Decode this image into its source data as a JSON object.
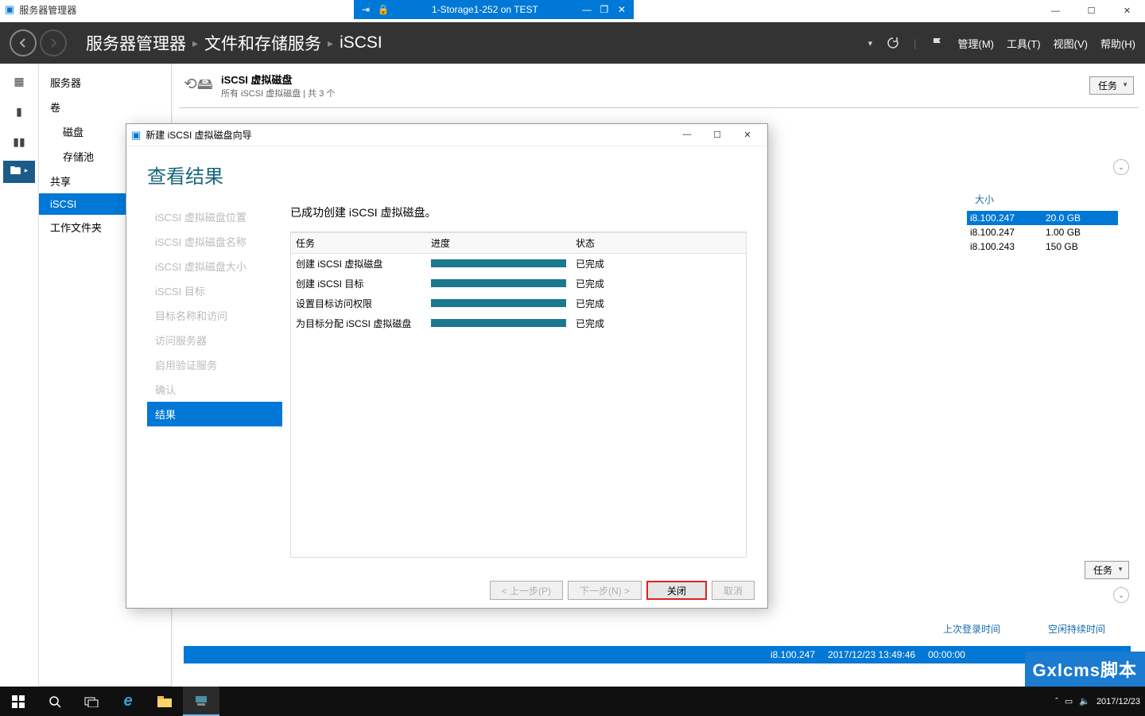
{
  "host_window": {
    "min": "—",
    "max": "☐",
    "close": "✕"
  },
  "vm_bar": {
    "title": "1-Storage1-252 on TEST",
    "pin": "📌",
    "lock": "🔒",
    "min": "—",
    "max": "❐",
    "close": "✕"
  },
  "sm_titlebar": {
    "title": "服务器管理器"
  },
  "breadcrumb": {
    "root": "服务器管理器",
    "mid": "文件和存储服务",
    "leaf": "iSCSI"
  },
  "top_menu": {
    "manage": "管理(M)",
    "tools": "工具(T)",
    "view": "视图(V)",
    "help": "帮助(H)"
  },
  "nav": {
    "servers": "服务器",
    "volumes": "卷",
    "disks": "磁盘",
    "pools": "存储池",
    "shares": "共享",
    "iscsi": "iSCSI",
    "workfolders": "工作文件夹"
  },
  "panel": {
    "title": "iSCSI 虚拟磁盘",
    "subtitle": "所有 iSCSI 虚拟磁盘 | 共 3 个",
    "tasks_label": "任务",
    "col_size": "大小"
  },
  "bg_rows": [
    {
      "ip": "i8.100.247",
      "size": "20.0 GB"
    },
    {
      "ip": "i8.100.247",
      "size": "1.00 GB"
    },
    {
      "ip": "i8.100.243",
      "size": "150 GB"
    }
  ],
  "lower": {
    "tasks_label": "任务",
    "last_login": "上次登录时间",
    "idle_time": "空闲持续时间",
    "row_ip": "i8.100.247",
    "row_time": "2017/12/23 13:49:46",
    "row_idle": "00:00:00"
  },
  "wizard": {
    "title": "新建 iSCSI 虚拟磁盘向导",
    "heading": "查看结果",
    "message": "已成功创建 iSCSI 虚拟磁盘。",
    "steps": [
      "iSCSI 虚拟磁盘位置",
      "iSCSI 虚拟磁盘名称",
      "iSCSI 虚拟磁盘大小",
      "iSCSI 目标",
      "目标名称和访问",
      "访问服务器",
      "启用验证服务",
      "确认",
      "结果"
    ],
    "table": {
      "col_task": "任务",
      "col_progress": "进度",
      "col_status": "状态",
      "rows": [
        {
          "task": "创建 iSCSI 虚拟磁盘",
          "status": "已完成"
        },
        {
          "task": "创建 iSCSI 目标",
          "status": "已完成"
        },
        {
          "task": "设置目标访问权限",
          "status": "已完成"
        },
        {
          "task": "为目标分配 iSCSI 虚拟磁盘",
          "status": "已完成"
        }
      ]
    },
    "btn_prev": "< 上一步(P)",
    "btn_next": "下一步(N) >",
    "btn_close": "关闭",
    "btn_cancel": "取消"
  },
  "taskbar": {
    "date": "2017/12/23"
  },
  "watermark": "Gxlcms脚本"
}
